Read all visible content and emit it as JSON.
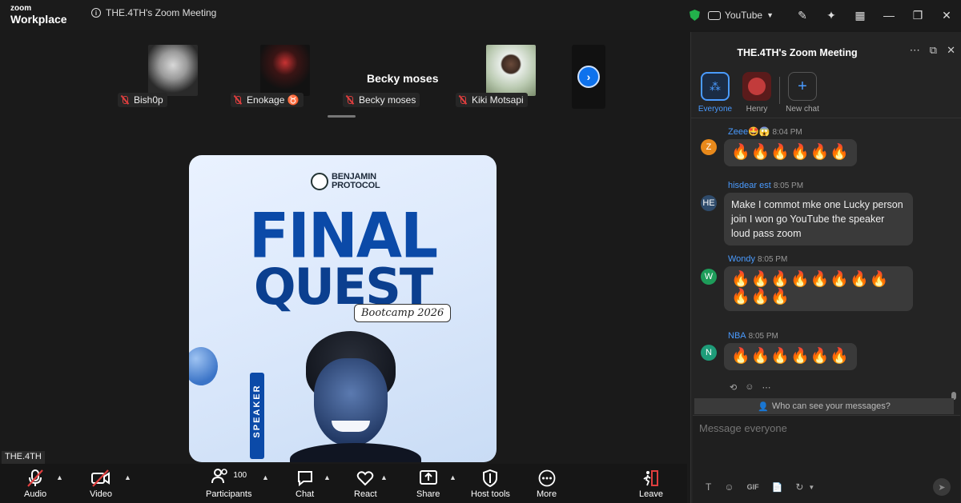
{
  "window": {
    "logo_top": "zoom",
    "logo_bottom": "Workplace",
    "meeting_title": "THE.4TH's Zoom Meeting",
    "streaming_label": "YouTube"
  },
  "participants_strip": {
    "tiles": [
      {
        "name": "Bish0p"
      },
      {
        "name": "Enokage ♉"
      },
      {
        "name": "Becky moses",
        "display_name": "Becky moses"
      },
      {
        "name": "Kiki Motsapi"
      }
    ]
  },
  "shared_content": {
    "brand_line1": "BENJAMIN",
    "brand_line2": "PROTOCOL",
    "headline1": "FINAL",
    "headline2": "QUEST",
    "tag": "Bootcamp 2026",
    "side_label": "SPEAKER"
  },
  "self_view_label": "THE.4TH",
  "toolbar": {
    "audio": "Audio",
    "video": "Video",
    "participants": "Participants",
    "participants_count": "100",
    "chat": "Chat",
    "react": "React",
    "share": "Share",
    "host_tools": "Host tools",
    "more": "More",
    "leave": "Leave"
  },
  "chat_panel": {
    "title": "THE.4TH's Zoom Meeting",
    "tabs": [
      {
        "label": "Everyone"
      },
      {
        "label": "Henry"
      },
      {
        "label": "New chat"
      }
    ],
    "messages": [
      {
        "initial": "Z",
        "avatar_color": "#e8891b",
        "sender": "Zeee🤩😱",
        "time": "8:04 PM",
        "text": "🔥🔥🔥🔥🔥🔥"
      },
      {
        "initial": "HE",
        "avatar_color": "#2f4b6b",
        "sender": "hisdear est",
        "time": "8:05 PM",
        "text": "Make I commot mke one Lucky person join I won go YouTube the speaker loud pass zoom"
      },
      {
        "initial": "W",
        "avatar_color": "#1e9c5a",
        "sender": "Wondy",
        "time": "8:05 PM",
        "text": "🔥🔥🔥🔥🔥🔥🔥🔥🔥🔥🔥"
      },
      {
        "initial": "N",
        "avatar_color": "#1e9c79",
        "sender": "NBA",
        "time": "8:05 PM",
        "text": "🔥🔥🔥🔥🔥🔥"
      }
    ],
    "visibility_notice": "Who can see your messages?",
    "compose_placeholder": "Message everyone",
    "compose_tools": [
      "T",
      "☺",
      "GIF",
      "📄",
      "↻"
    ]
  },
  "colors": {
    "accent": "#0e72ed",
    "link": "#4a9bff",
    "mute_red": "#e03e3e",
    "panel_bg": "#242424"
  }
}
